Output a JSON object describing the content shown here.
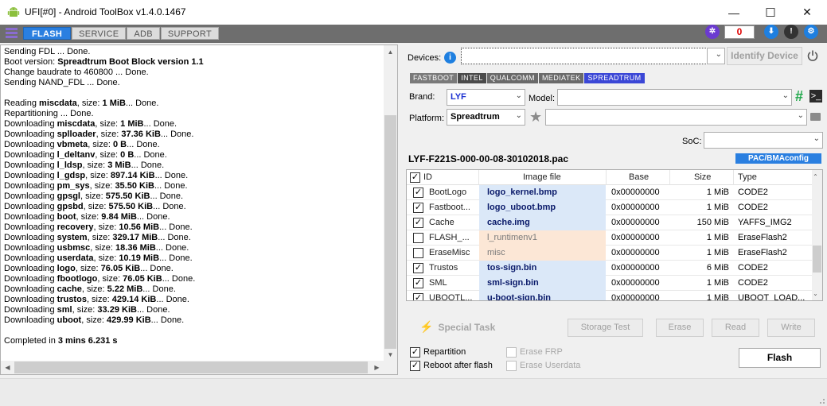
{
  "window": {
    "title": "UFI[#0] - Android ToolBox v1.4.0.1467",
    "minimize_glyph": "—",
    "maximize_glyph": "☐",
    "close_glyph": "✕"
  },
  "tabs": [
    "FLASH",
    "SERVICE",
    "ADB",
    "SUPPORT"
  ],
  "counter": "0",
  "log": {
    "lines": [
      [
        [
          "Sending FDL ... Done.",
          false
        ]
      ],
      [
        [
          "Boot version: ",
          false
        ],
        [
          "Spreadtrum Boot Block version 1.1",
          true
        ]
      ],
      [
        [
          "Change baudrate to 460800 ... Done.",
          false
        ]
      ],
      [
        [
          "Sending NAND_FDL ... Done.",
          false
        ]
      ],
      [
        [
          "",
          false
        ]
      ],
      [
        [
          "Reading ",
          false
        ],
        [
          "miscdata",
          true
        ],
        [
          ", size: ",
          false
        ],
        [
          "1 MiB",
          true
        ],
        [
          "... Done.",
          false
        ]
      ],
      [
        [
          "Repartitioning ... Done.",
          false
        ]
      ],
      [
        [
          "Downloading ",
          false
        ],
        [
          "miscdata",
          true
        ],
        [
          ", size: ",
          false
        ],
        [
          "1 MiB",
          true
        ],
        [
          "... Done.",
          false
        ]
      ],
      [
        [
          "Downloading ",
          false
        ],
        [
          "splloader",
          true
        ],
        [
          ", size: ",
          false
        ],
        [
          "37.36 KiB",
          true
        ],
        [
          "... Done.",
          false
        ]
      ],
      [
        [
          "Downloading ",
          false
        ],
        [
          "vbmeta",
          true
        ],
        [
          ", size: ",
          false
        ],
        [
          "0 B",
          true
        ],
        [
          "... Done.",
          false
        ]
      ],
      [
        [
          "Downloading ",
          false
        ],
        [
          "l_deltanv",
          true
        ],
        [
          ", size: ",
          false
        ],
        [
          "0 B",
          true
        ],
        [
          "... Done.",
          false
        ]
      ],
      [
        [
          "Downloading ",
          false
        ],
        [
          "l_ldsp",
          true
        ],
        [
          ", size: ",
          false
        ],
        [
          "3 MiB",
          true
        ],
        [
          "... Done.",
          false
        ]
      ],
      [
        [
          "Downloading ",
          false
        ],
        [
          "l_gdsp",
          true
        ],
        [
          ", size: ",
          false
        ],
        [
          "897.14 KiB",
          true
        ],
        [
          "... Done.",
          false
        ]
      ],
      [
        [
          "Downloading ",
          false
        ],
        [
          "pm_sys",
          true
        ],
        [
          ", size: ",
          false
        ],
        [
          "35.50 KiB",
          true
        ],
        [
          "... Done.",
          false
        ]
      ],
      [
        [
          "Downloading ",
          false
        ],
        [
          "gpsgl",
          true
        ],
        [
          ", size: ",
          false
        ],
        [
          "575.50 KiB",
          true
        ],
        [
          "... Done.",
          false
        ]
      ],
      [
        [
          "Downloading ",
          false
        ],
        [
          "gpsbd",
          true
        ],
        [
          ", size: ",
          false
        ],
        [
          "575.50 KiB",
          true
        ],
        [
          "... Done.",
          false
        ]
      ],
      [
        [
          "Downloading ",
          false
        ],
        [
          "boot",
          true
        ],
        [
          ", size: ",
          false
        ],
        [
          "9.84 MiB",
          true
        ],
        [
          "... Done.",
          false
        ]
      ],
      [
        [
          "Downloading ",
          false
        ],
        [
          "recovery",
          true
        ],
        [
          ", size: ",
          false
        ],
        [
          "10.56 MiB",
          true
        ],
        [
          "... Done.",
          false
        ]
      ],
      [
        [
          "Downloading ",
          false
        ],
        [
          "system",
          true
        ],
        [
          ", size: ",
          false
        ],
        [
          "329.17 MiB",
          true
        ],
        [
          "... Done.",
          false
        ]
      ],
      [
        [
          "Downloading ",
          false
        ],
        [
          "usbmsc",
          true
        ],
        [
          ", size: ",
          false
        ],
        [
          "18.36 MiB",
          true
        ],
        [
          "... Done.",
          false
        ]
      ],
      [
        [
          "Downloading ",
          false
        ],
        [
          "userdata",
          true
        ],
        [
          ", size: ",
          false
        ],
        [
          "10.19 MiB",
          true
        ],
        [
          "... Done.",
          false
        ]
      ],
      [
        [
          "Downloading ",
          false
        ],
        [
          "logo",
          true
        ],
        [
          ", size: ",
          false
        ],
        [
          "76.05 KiB",
          true
        ],
        [
          "... Done.",
          false
        ]
      ],
      [
        [
          "Downloading ",
          false
        ],
        [
          "fbootlogo",
          true
        ],
        [
          ", size: ",
          false
        ],
        [
          "76.05 KiB",
          true
        ],
        [
          "... Done.",
          false
        ]
      ],
      [
        [
          "Downloading ",
          false
        ],
        [
          "cache",
          true
        ],
        [
          ", size: ",
          false
        ],
        [
          "5.22 MiB",
          true
        ],
        [
          "... Done.",
          false
        ]
      ],
      [
        [
          "Downloading ",
          false
        ],
        [
          "trustos",
          true
        ],
        [
          ", size: ",
          false
        ],
        [
          "429.14 KiB",
          true
        ],
        [
          "... Done.",
          false
        ]
      ],
      [
        [
          "Downloading ",
          false
        ],
        [
          "sml",
          true
        ],
        [
          ", size: ",
          false
        ],
        [
          "33.29 KiB",
          true
        ],
        [
          "... Done.",
          false
        ]
      ],
      [
        [
          "Downloading ",
          false
        ],
        [
          "uboot",
          true
        ],
        [
          ", size: ",
          false
        ],
        [
          "429.99 KiB",
          true
        ],
        [
          "... Done.",
          false
        ]
      ],
      [
        [
          "",
          false
        ]
      ],
      [
        [
          "Completed in ",
          false
        ],
        [
          "3 mins 6.231 s",
          true
        ]
      ]
    ]
  },
  "devices": {
    "label": "Devices:",
    "value": "",
    "identify_label": "Identify Device"
  },
  "chipsets": [
    {
      "label": "FASTBOOT",
      "color": "#7a7a7a"
    },
    {
      "label": "INTEL",
      "color": "#4a4a4a"
    },
    {
      "label": "QUALCOMM",
      "color": "#6a6a6a"
    },
    {
      "label": "MEDIATEK",
      "color": "#6a6a6a"
    },
    {
      "label": "SPREADTRUM",
      "color": "#3b47d6"
    }
  ],
  "brand": {
    "label": "Brand:",
    "value": "LYF",
    "color": "#1a2fd0"
  },
  "model": {
    "label": "Model:",
    "value": ""
  },
  "platform": {
    "label": "Platform:",
    "value": "Spreadtrum"
  },
  "platform_extra": {
    "value": ""
  },
  "soc": {
    "label": "SoC:",
    "value": ""
  },
  "pac": {
    "file": "LYF-F221S-000-00-08-30102018.pac",
    "config_label": "PAC/BMAconfig"
  },
  "table": {
    "columns": [
      "ID",
      "Image file",
      "Base",
      "Size",
      "Type"
    ],
    "rows": [
      {
        "checked": true,
        "id": "BootLogo",
        "file": "logo_kernel.bmp",
        "base": "0x00000000",
        "size": "1 MiB",
        "type": "CODE2",
        "style": "blue"
      },
      {
        "checked": true,
        "id": "Fastboot...",
        "file": "logo_uboot.bmp",
        "base": "0x00000000",
        "size": "1 MiB",
        "type": "CODE2",
        "style": "blue"
      },
      {
        "checked": true,
        "id": "Cache",
        "file": "cache.img",
        "base": "0x00000000",
        "size": "150 MiB",
        "type": "YAFFS_IMG2",
        "style": "blue"
      },
      {
        "checked": false,
        "id": "FLASH_...",
        "file": "l_runtimenv1",
        "base": "0x00000000",
        "size": "1 MiB",
        "type": "EraseFlash2",
        "style": "peach"
      },
      {
        "checked": false,
        "id": "EraseMisc",
        "file": "misc",
        "base": "0x00000000",
        "size": "1 MiB",
        "type": "EraseFlash2",
        "style": "peach"
      },
      {
        "checked": true,
        "id": "Trustos",
        "file": "tos-sign.bin",
        "base": "0x00000000",
        "size": "6 MiB",
        "type": "CODE2",
        "style": "blue"
      },
      {
        "checked": true,
        "id": "SML",
        "file": "sml-sign.bin",
        "base": "0x00000000",
        "size": "1 MiB",
        "type": "CODE2",
        "style": "blue"
      },
      {
        "checked": true,
        "id": "UBOOTL...",
        "file": "u-boot-sign.bin",
        "base": "0x00000000",
        "size": "1 MiB",
        "type": "UBOOT_LOAD...",
        "style": "blue"
      }
    ]
  },
  "actions": {
    "special_task": "Special Task",
    "storage_test": "Storage Test",
    "erase": "Erase",
    "read": "Read",
    "write": "Write",
    "flash": "Flash"
  },
  "options": {
    "repartition": {
      "label": "Repartition",
      "checked": true
    },
    "reboot": {
      "label": "Reboot after flash",
      "checked": true
    },
    "erase_frp": {
      "label": "Erase FRP",
      "checked": false
    },
    "erase_userdata": {
      "label": "Erase Userdata",
      "checked": false
    }
  }
}
